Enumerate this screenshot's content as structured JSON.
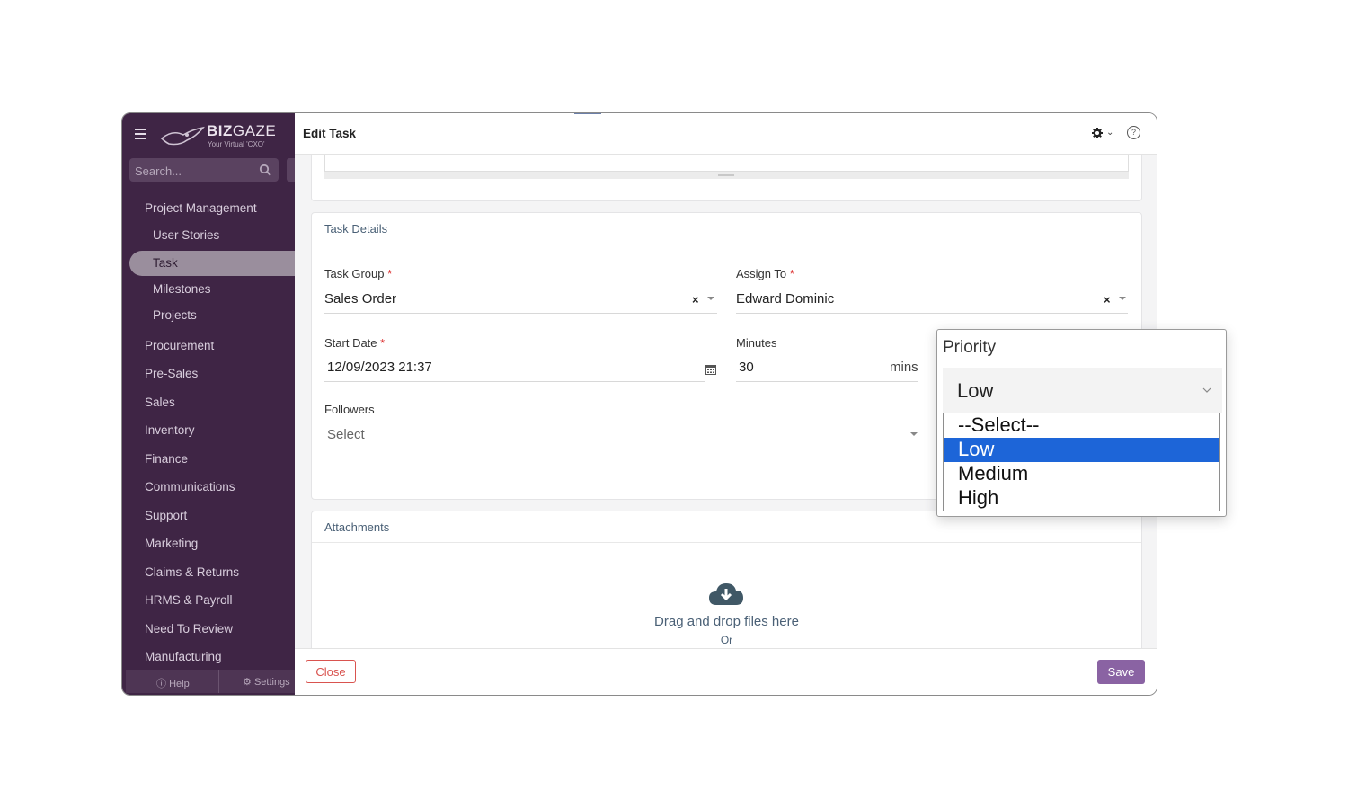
{
  "sidebar": {
    "brand": "BIZ",
    "brand2": "GAZE",
    "tagline": "Your Virtual 'CXO'",
    "search_placeholder": "Search...",
    "items": [
      {
        "label": "Project Management",
        "level": 0
      },
      {
        "label": "User Stories",
        "level": 1
      },
      {
        "label": "Task",
        "level": 1,
        "active": true
      },
      {
        "label": "Milestones",
        "level": 1
      },
      {
        "label": "Projects",
        "level": 1
      },
      {
        "label": "Procurement",
        "level": 0
      },
      {
        "label": "Pre-Sales",
        "level": 0
      },
      {
        "label": "Sales",
        "level": 0
      },
      {
        "label": "Inventory",
        "level": 0
      },
      {
        "label": "Finance",
        "level": 0
      },
      {
        "label": "Communications",
        "level": 0
      },
      {
        "label": "Support",
        "level": 0
      },
      {
        "label": "Marketing",
        "level": 0
      },
      {
        "label": "Claims & Returns",
        "level": 0
      },
      {
        "label": "HRMS & Payroll",
        "level": 0
      },
      {
        "label": "Need To Review",
        "level": 0
      },
      {
        "label": "Manufacturing",
        "level": 0
      }
    ],
    "footer": {
      "help": "Help",
      "settings": "Settings"
    }
  },
  "header": {
    "title": "Edit Task"
  },
  "task_details": {
    "section_title": "Task Details",
    "task_group": {
      "label": "Task Group",
      "value": "Sales Order"
    },
    "assign_to": {
      "label": "Assign To",
      "value": "Edward Dominic"
    },
    "start_date": {
      "label": "Start Date",
      "value": "12/09/2023 21:37"
    },
    "minutes": {
      "label": "Minutes",
      "value": "30",
      "unit": "mins"
    },
    "followers": {
      "label": "Followers",
      "placeholder": "Select"
    },
    "required_mark": "*"
  },
  "attachments": {
    "section_title": "Attachments",
    "drag_text": "Drag and drop files here",
    "or_text": "Or"
  },
  "footer": {
    "close_label": "Close",
    "save_label": "Save"
  },
  "priority": {
    "label": "Priority",
    "selected": "Low",
    "options": [
      "--Select--",
      "Low",
      "Medium",
      "High"
    ],
    "highlighted_index": 1
  },
  "colors": {
    "sidebar_bg": "#3f2545",
    "save_button": "#8a63a3",
    "close_button": "#d9534f",
    "option_highlight": "#1d65d8"
  }
}
